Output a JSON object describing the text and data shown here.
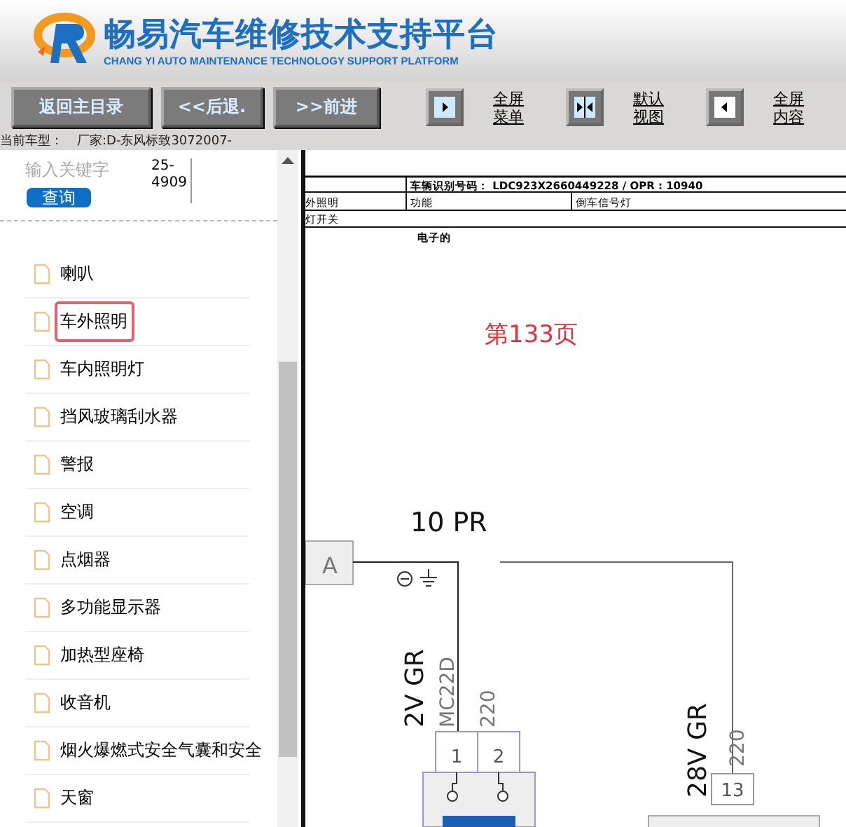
{
  "header": {
    "title": "畅易汽车维修技术支持平台",
    "subtitle": "CHANG YI AUTO MAINTENANCE TECHNOLOGY SUPPORT PLATFORM"
  },
  "toolbar": {
    "nav_buttons": [
      "返回主目录",
      "<<后退.",
      ">>前进"
    ],
    "view_buttons": [
      {
        "kind": "right",
        "label": "全屏菜单"
      },
      {
        "kind": "split",
        "label": "默认视图"
      },
      {
        "kind": "left",
        "label": "全屏内容"
      }
    ]
  },
  "status": {
    "label": "当前车型：",
    "value": "厂家:D-东风标致3072007-"
  },
  "sidebar": {
    "search": {
      "placeholder": "输入关键字",
      "note": "25-4909",
      "button": "查询"
    },
    "items": [
      {
        "label": "喇叭",
        "selected": false
      },
      {
        "label": "车外照明",
        "selected": true
      },
      {
        "label": "车内照明灯",
        "selected": false
      },
      {
        "label": "挡风玻璃刮水器",
        "selected": false
      },
      {
        "label": "警报",
        "selected": false
      },
      {
        "label": "空调",
        "selected": false
      },
      {
        "label": "点烟器",
        "selected": false
      },
      {
        "label": "多功能显示器",
        "selected": false
      },
      {
        "label": "加热型座椅",
        "selected": false
      },
      {
        "label": "收音机",
        "selected": false
      },
      {
        "label": "烟火爆燃式安全气囊和安全",
        "selected": false
      },
      {
        "label": "天窗",
        "selected": false
      }
    ]
  },
  "document": {
    "header_table": {
      "vin": "车辆识别号码：  LDC923X2660449228 / OPR : 10940",
      "system": "外照明",
      "function_label": "功能",
      "function": "倒车信号灯",
      "component": "灯开关",
      "type": "电子的"
    },
    "page_label": "第133页",
    "diagram": {
      "connector": "10 PR",
      "fuse": "A",
      "labels": [
        "2V GR",
        "MC22D",
        "220",
        "28V GR",
        "220"
      ],
      "pins": [
        "1",
        "2",
        "13"
      ]
    }
  }
}
